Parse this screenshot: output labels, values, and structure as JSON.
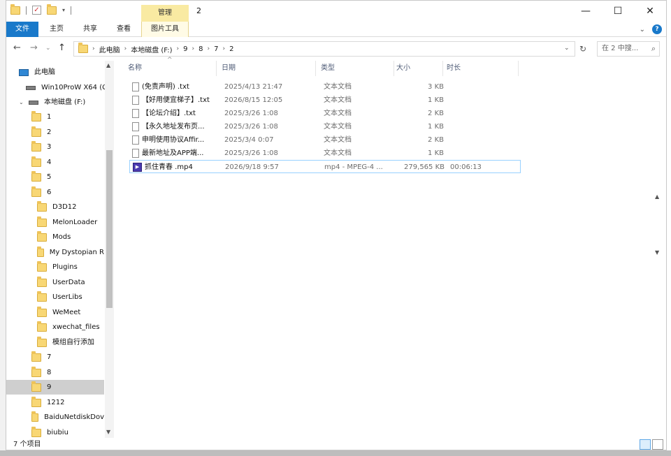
{
  "window": {
    "title": "2",
    "manage_tab": "管理"
  },
  "ribbon": {
    "tabs": [
      "文件",
      "主页",
      "共享",
      "查看",
      "图片工具"
    ]
  },
  "address": {
    "path": [
      "此电脑",
      "本地磁盘 (F:)",
      "9",
      "8",
      "7",
      "2"
    ],
    "search_placeholder": "在 2 中搜..."
  },
  "nav": {
    "items": [
      {
        "label": "此电脑",
        "kind": "pc"
      },
      {
        "label": "Win10ProW X64 (C",
        "kind": "drive"
      },
      {
        "label": "本地磁盘 (F:)",
        "kind": "drive"
      },
      {
        "label": "1",
        "kind": "folder"
      },
      {
        "label": "2",
        "kind": "folder"
      },
      {
        "label": "3",
        "kind": "folder"
      },
      {
        "label": "4",
        "kind": "folder"
      },
      {
        "label": "5",
        "kind": "folder"
      },
      {
        "label": "6",
        "kind": "folder"
      },
      {
        "label": "D3D12",
        "kind": "folder"
      },
      {
        "label": "MelonLoader",
        "kind": "folder"
      },
      {
        "label": "Mods",
        "kind": "folder"
      },
      {
        "label": "My Dystopian R",
        "kind": "folder"
      },
      {
        "label": "Plugins",
        "kind": "folder"
      },
      {
        "label": "UserData",
        "kind": "folder"
      },
      {
        "label": "UserLibs",
        "kind": "folder"
      },
      {
        "label": "WeMeet",
        "kind": "folder"
      },
      {
        "label": "xwechat_files",
        "kind": "folder"
      },
      {
        "label": "模组自行添加",
        "kind": "folder"
      },
      {
        "label": "7",
        "kind": "folder"
      },
      {
        "label": "8",
        "kind": "folder"
      },
      {
        "label": "9",
        "kind": "folder",
        "selected": true
      },
      {
        "label": "1212",
        "kind": "folder"
      },
      {
        "label": "BaiduNetdiskDov",
        "kind": "folder"
      },
      {
        "label": "biubiu",
        "kind": "folder"
      }
    ]
  },
  "columns": {
    "name": "名称",
    "date": "日期",
    "type": "类型",
    "size": "大小",
    "duration": "时长"
  },
  "files": [
    {
      "name": "(免责声明) .txt",
      "date": "2025/4/13 21:47",
      "type": "文本文档",
      "size": "3 KB",
      "duration": "",
      "icon": "txt-icon"
    },
    {
      "name": "【好用便宜梯子】.txt",
      "date": "2026/8/15 12:05",
      "type": "文本文档",
      "size": "1 KB",
      "duration": "",
      "icon": "txt-icon"
    },
    {
      "name": "【论坛介绍】.txt",
      "date": "2025/3/26 1:08",
      "type": "文本文档",
      "size": "2 KB",
      "duration": "",
      "icon": "txt-icon"
    },
    {
      "name": "【永久地址发布页...",
      "date": "2025/3/26 1:08",
      "type": "文本文档",
      "size": "1 KB",
      "duration": "",
      "icon": "txt-icon"
    },
    {
      "name": "申明使用协议Affir...",
      "date": "2025/3/4 0:07",
      "type": "文本文档",
      "size": "2 KB",
      "duration": "",
      "icon": "txt-icon"
    },
    {
      "name": "最新地址及APP端...",
      "date": "2025/3/26 1:08",
      "type": "文本文档",
      "size": "1 KB",
      "duration": "",
      "icon": "txt-icon"
    },
    {
      "name": "抓住青春 .mp4",
      "date": "2026/9/18 9:57",
      "type": "mp4 - MPEG-4 ...",
      "size": "279,565 KB",
      "duration": "00:06:13",
      "icon": "mp4-icon",
      "selected": true
    }
  ],
  "status": {
    "count": "7 个项目"
  }
}
